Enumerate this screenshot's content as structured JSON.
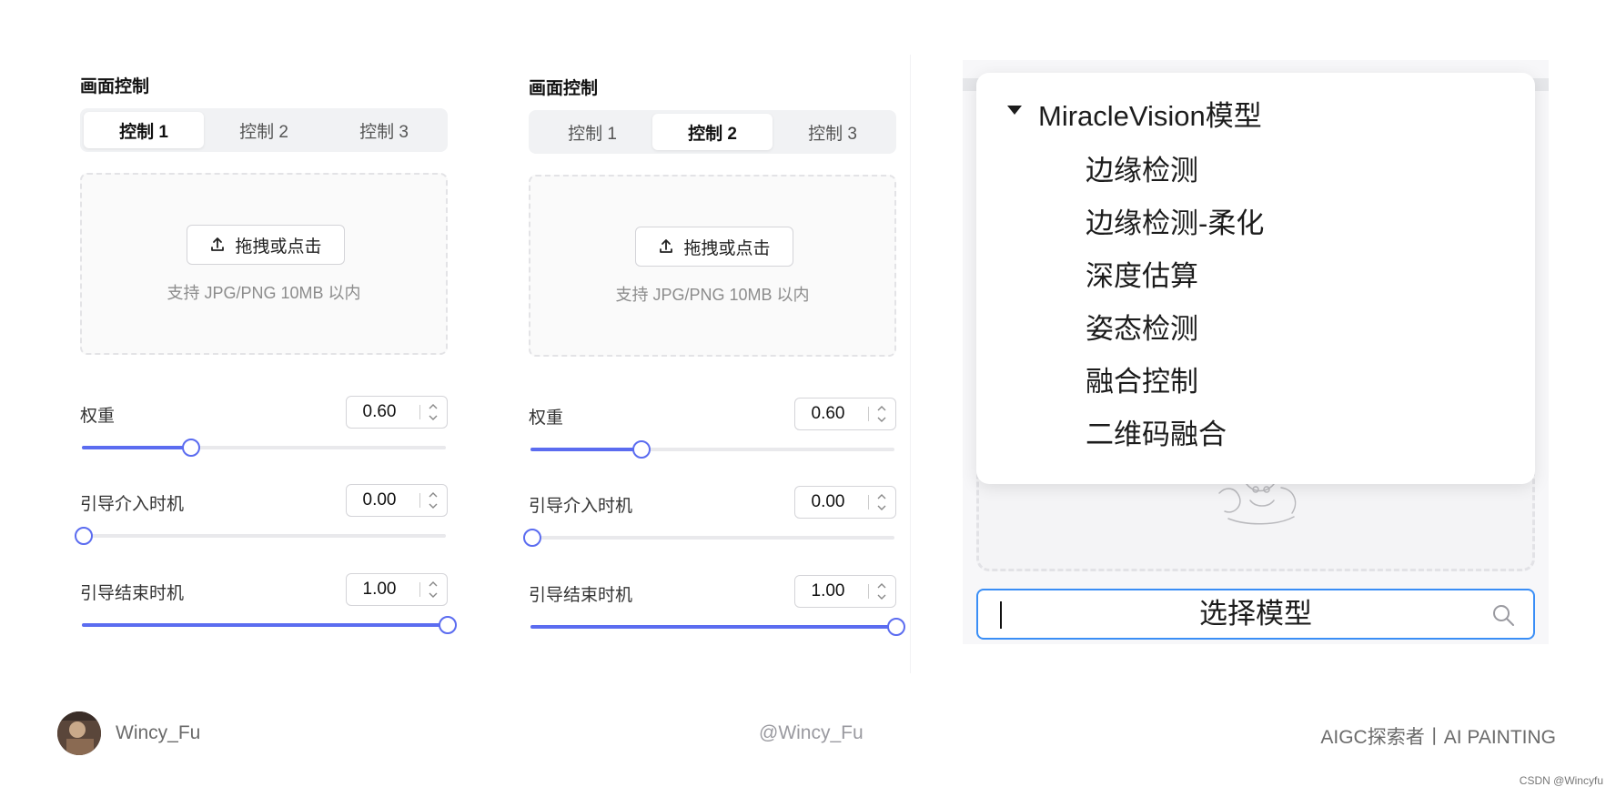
{
  "panels": [
    {
      "title": "画面控制",
      "tabs": [
        "控制 1",
        "控制 2",
        "控制 3"
      ],
      "active_tab": 0,
      "upload": {
        "button_label": "拖拽或点击",
        "hint": "支持 JPG/PNG 10MB 以内"
      },
      "params": [
        {
          "label": "权重",
          "value": "0.60",
          "slider_fraction": 0.3
        },
        {
          "label": "引导介入时机",
          "value": "0.00",
          "slider_fraction": 0.0
        },
        {
          "label": "引导结束时机",
          "value": "1.00",
          "slider_fraction": 1.0
        }
      ]
    },
    {
      "title": "画面控制",
      "tabs": [
        "控制 1",
        "控制 2",
        "控制 3"
      ],
      "active_tab": 1,
      "upload": {
        "button_label": "拖拽或点击",
        "hint": "支持 JPG/PNG 10MB 以内"
      },
      "params": [
        {
          "label": "权重",
          "value": "0.60",
          "slider_fraction": 0.3
        },
        {
          "label": "引导介入时机",
          "value": "0.00",
          "slider_fraction": 0.0
        },
        {
          "label": "引导结束时机",
          "value": "1.00",
          "slider_fraction": 1.0
        }
      ]
    }
  ],
  "model_dropdown": {
    "group_label": "MiracleVision模型",
    "items": [
      "边缘检测",
      "边缘检测-柔化",
      "深度估算",
      "姿态检测",
      "融合控制",
      "二维码融合"
    ]
  },
  "search": {
    "value": "选择模型"
  },
  "footer": {
    "author": "Wincy_Fu",
    "handle": "@Wincy_Fu",
    "tagline": "AIGC探索者丨AI PAINTING",
    "watermark": "CSDN @Wincyfu"
  },
  "colors": {
    "accent": "#5b6cf0",
    "focus": "#3a8ef6",
    "track": "#e9e9ec"
  }
}
